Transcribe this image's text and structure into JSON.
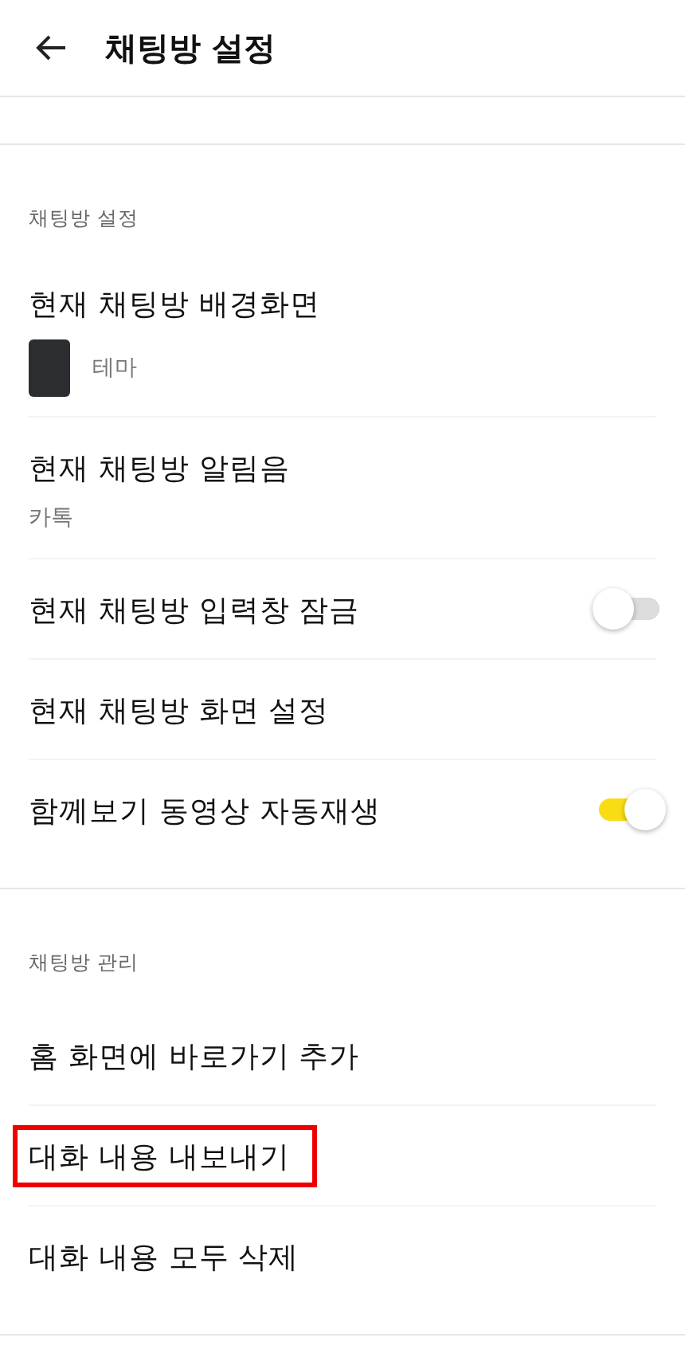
{
  "header": {
    "title": "채팅방 설정"
  },
  "sections": [
    {
      "label": "채팅방 설정",
      "items": [
        {
          "kind": "thumb",
          "title": "현재 채팅방 배경화면",
          "subtitle": "테마",
          "highlighted": false
        },
        {
          "kind": "subtitle",
          "title": "현재 채팅방 알림음",
          "subtitle": "카톡",
          "highlighted": false
        },
        {
          "kind": "toggle",
          "title": "현재 채팅방 입력창 잠금",
          "on": false,
          "highlighted": false
        },
        {
          "kind": "plain",
          "title": "현재 채팅방 화면 설정",
          "highlighted": false
        },
        {
          "kind": "toggle",
          "title": "함께보기 동영상 자동재생",
          "on": true,
          "highlighted": false
        }
      ]
    },
    {
      "label": "채팅방 관리",
      "items": [
        {
          "kind": "plain",
          "title": "홈 화면에 바로가기 추가",
          "highlighted": false
        },
        {
          "kind": "plain",
          "title": "대화 내용 내보내기",
          "highlighted": true
        },
        {
          "kind": "plain",
          "title": "대화 내용 모두 삭제",
          "highlighted": false
        }
      ]
    }
  ]
}
